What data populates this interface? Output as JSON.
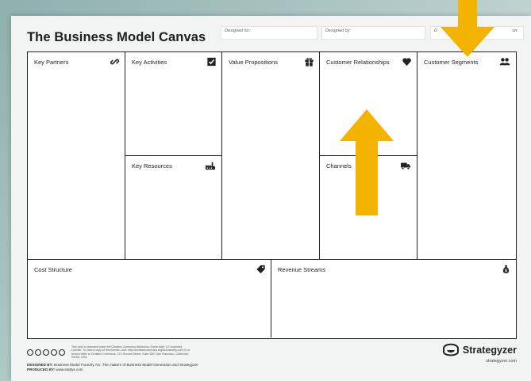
{
  "title": "The Business Model Canvas",
  "meta": {
    "designed_for": "Designed for:",
    "designed_by": "Designed by:",
    "date_partial": "D",
    "iteration_partial": "on:"
  },
  "blocks": {
    "key_partners": "Key Partners",
    "key_activities": "Key Activities",
    "key_resources": "Key Resources",
    "value_propositions": "Value Propositions",
    "customer_relationships": "Customer Relationships",
    "channels": "Channels",
    "customer_segments": "Customer Segments",
    "cost_structure": "Cost Structure",
    "revenue_streams": "Revenue Streams"
  },
  "icons": {
    "key_partners": "link-icon",
    "key_activities": "checkbox-icon",
    "key_resources": "factory-icon",
    "value_propositions": "gift-icon",
    "customer_relationships": "heart-icon",
    "channels": "truck-icon",
    "customer_segments": "people-icon",
    "cost_structure": "price-tag-icon",
    "revenue_streams": "money-bag-icon"
  },
  "footer": {
    "license_text": "This work is licensed under the Creative Commons Attribution-Share Alike 3.0 Unported License. To view a copy of this license, visit: http://creativecommons.org/licenses/by-sa/3.0/ or send a letter to Creative Commons, 171 Second Street, Suite 300, San Francisco, California, 94105, USA.",
    "designed_by_label": "DESIGNED BY:",
    "designed_by_text": "Business Model Foundry AG. The makers of Business Model Generation and Strategyzer",
    "produced_by_label": "PRODUCED BY:",
    "produced_by_text": "www.stattys.com"
  },
  "brand": {
    "name": "Strategyzer",
    "url": "strategyzer.com"
  },
  "colors": {
    "arrow": "#f5b301",
    "grid_border": "#222222",
    "background": "#a9c4c2"
  }
}
